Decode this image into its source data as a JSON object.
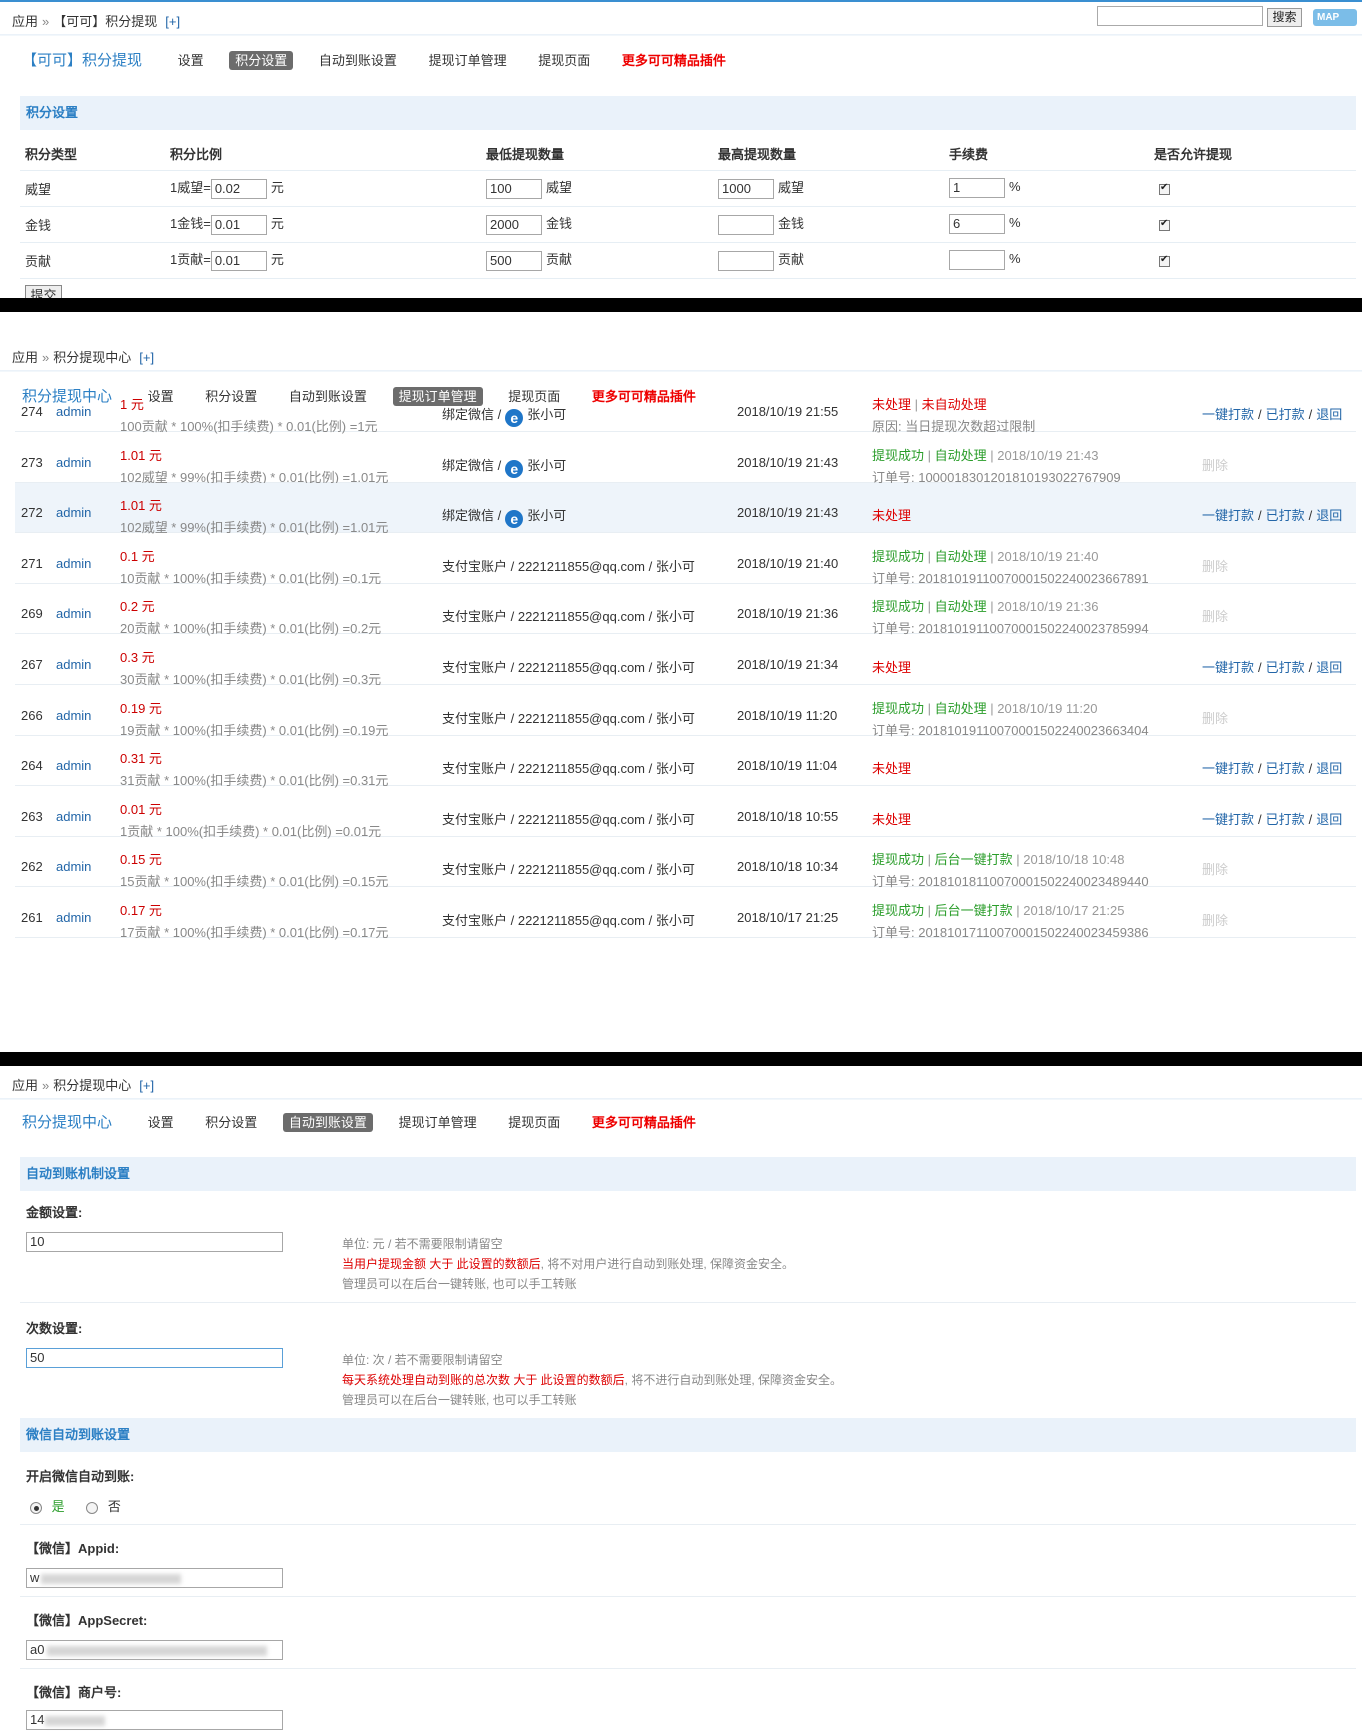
{
  "panel1": {
    "breadcrumb": [
      "应用",
      "【可可】积分提现"
    ],
    "breadcrumb_plus": "[+]",
    "search_button": "搜索",
    "map_button": "MAP",
    "nav": {
      "brand": "【可可】积分提现",
      "items": [
        "设置",
        "积分设置",
        "自动到账设置",
        "提现订单管理",
        "提现页面"
      ],
      "active_index": 1,
      "more": "更多可可精品插件"
    },
    "section_title": "积分设置",
    "table": {
      "headers": [
        "积分类型",
        "积分比例",
        "最低提现数量",
        "最高提现数量",
        "手续费",
        "是否允许提现"
      ],
      "rows": [
        {
          "type": "威望",
          "ratio_prefix": "1威望=",
          "ratio": "0.02",
          "ratio_unit": "元",
          "min": "100",
          "min_unit": "威望",
          "max": "1000",
          "max_unit": "威望",
          "fee": "1",
          "fee_unit": "%",
          "allowed": true
        },
        {
          "type": "金钱",
          "ratio_prefix": "1金钱=",
          "ratio": "0.01",
          "ratio_unit": "元",
          "min": "2000",
          "min_unit": "金钱",
          "max": "",
          "max_unit": "金钱",
          "fee": "6",
          "fee_unit": "%",
          "allowed": true
        },
        {
          "type": "贡献",
          "ratio_prefix": "1贡献=",
          "ratio": "0.01",
          "ratio_unit": "元",
          "min": "500",
          "min_unit": "贡献",
          "max": "",
          "max_unit": "贡献",
          "fee": "",
          "fee_unit": "%",
          "allowed": true
        }
      ]
    },
    "submit": "提交"
  },
  "panel2": {
    "breadcrumb": [
      "应用",
      "积分提现中心"
    ],
    "breadcrumb_plus": "[+]",
    "nav": {
      "brand": "积分提现中心",
      "items": [
        "设置",
        "积分设置",
        "自动到账设置",
        "提现订单管理",
        "提现页面"
      ],
      "active_index": 3,
      "more": "更多可可精品插件"
    },
    "ops": [
      "一键打款",
      "已打款",
      "退回"
    ],
    "delete_label": "删除",
    "orders": [
      {
        "id": "274",
        "user": "admin",
        "amount": "1 元",
        "formula": "100贡献 * 100%(扣手续费) * 0.01(比例) =1元",
        "account": "绑定微信 /",
        "account_name": "张小可",
        "wechat": true,
        "time": "2018/10/19 21:55",
        "status": "未处理",
        "status2": "未自动处理",
        "status_time": "",
        "note": "原因: 当日提现次数超过限制",
        "processed": false
      },
      {
        "id": "273",
        "user": "admin",
        "amount": "1.01 元",
        "formula": "102威望 * 99%(扣手续费) * 0.01(比例) =1.01元",
        "account": "绑定微信 /",
        "account_name": "张小可",
        "wechat": true,
        "time": "2018/10/19 21:43",
        "status": "提现成功",
        "status2": "自动处理",
        "status_time": "2018/10/19 21:43",
        "note": "订单号: 1000018301201810193022767909",
        "processed": true
      },
      {
        "id": "272",
        "user": "admin",
        "amount": "1.01 元",
        "formula": "102威望 * 99%(扣手续费) * 0.01(比例) =1.01元",
        "account": "绑定微信 /",
        "account_name": "张小可",
        "wechat": true,
        "time": "2018/10/19 21:43",
        "status": "未处理",
        "status2": "",
        "status_time": "",
        "note": "",
        "processed": false
      },
      {
        "id": "271",
        "user": "admin",
        "amount": "0.1 元",
        "formula": "10贡献 * 100%(扣手续费) * 0.01(比例) =0.1元",
        "account": "支付宝账户 / 2221211855@qq.com / 张小可",
        "account_name": "",
        "wechat": false,
        "time": "2018/10/19 21:40",
        "status": "提现成功",
        "status2": "自动处理",
        "status_time": "2018/10/19 21:40",
        "note": "订单号: 20181019110070001502240023667891",
        "processed": true
      },
      {
        "id": "269",
        "user": "admin",
        "amount": "0.2 元",
        "formula": "20贡献 * 100%(扣手续费) * 0.01(比例) =0.2元",
        "account": "支付宝账户 / 2221211855@qq.com / 张小可",
        "account_name": "",
        "wechat": false,
        "time": "2018/10/19 21:36",
        "status": "提现成功",
        "status2": "自动处理",
        "status_time": "2018/10/19 21:36",
        "note": "订单号: 20181019110070001502240023785994",
        "processed": true
      },
      {
        "id": "267",
        "user": "admin",
        "amount": "0.3 元",
        "formula": "30贡献 * 100%(扣手续费) * 0.01(比例) =0.3元",
        "account": "支付宝账户 / 2221211855@qq.com / 张小可",
        "account_name": "",
        "wechat": false,
        "time": "2018/10/19 21:34",
        "status": "未处理",
        "status2": "",
        "status_time": "",
        "note": "",
        "processed": false
      },
      {
        "id": "266",
        "user": "admin",
        "amount": "0.19 元",
        "formula": "19贡献 * 100%(扣手续费) * 0.01(比例) =0.19元",
        "account": "支付宝账户 / 2221211855@qq.com / 张小可",
        "account_name": "",
        "wechat": false,
        "time": "2018/10/19 11:20",
        "status": "提现成功",
        "status2": "自动处理",
        "status_time": "2018/10/19 11:20",
        "note": "订单号: 20181019110070001502240023663404",
        "processed": true
      },
      {
        "id": "264",
        "user": "admin",
        "amount": "0.31 元",
        "formula": "31贡献 * 100%(扣手续费) * 0.01(比例) =0.31元",
        "account": "支付宝账户 / 2221211855@qq.com / 张小可",
        "account_name": "",
        "wechat": false,
        "time": "2018/10/19 11:04",
        "status": "未处理",
        "status2": "",
        "status_time": "",
        "note": "",
        "processed": false
      },
      {
        "id": "263",
        "user": "admin",
        "amount": "0.01 元",
        "formula": "1贡献 * 100%(扣手续费) * 0.01(比例) =0.01元",
        "account": "支付宝账户 / 2221211855@qq.com / 张小可",
        "account_name": "",
        "wechat": false,
        "time": "2018/10/18 10:55",
        "status": "未处理",
        "status2": "",
        "status_time": "",
        "note": "",
        "processed": false
      },
      {
        "id": "262",
        "user": "admin",
        "amount": "0.15 元",
        "formula": "15贡献 * 100%(扣手续费) * 0.01(比例) =0.15元",
        "account": "支付宝账户 / 2221211855@qq.com / 张小可",
        "account_name": "",
        "wechat": false,
        "time": "2018/10/18 10:34",
        "status": "提现成功",
        "status2": "后台一键打款",
        "status_time": "2018/10/18 10:48",
        "note": "订单号: 20181018110070001502240023489440",
        "processed": true
      },
      {
        "id": "261",
        "user": "admin",
        "amount": "0.17 元",
        "formula": "17贡献 * 100%(扣手续费) * 0.01(比例) =0.17元",
        "account": "支付宝账户 / 2221211855@qq.com / 张小可",
        "account_name": "",
        "wechat": false,
        "time": "2018/10/17 21:25",
        "status": "提现成功",
        "status2": "后台一键打款",
        "status_time": "2018/10/17 21:25",
        "note": "订单号: 20181017110070001502240023459386",
        "processed": true
      }
    ]
  },
  "panel3": {
    "breadcrumb": [
      "应用",
      "积分提现中心"
    ],
    "breadcrumb_plus": "[+]",
    "nav": {
      "brand": "积分提现中心",
      "items": [
        "设置",
        "积分设置",
        "自动到账设置",
        "提现订单管理",
        "提现页面"
      ],
      "active_index": 2,
      "more": "更多可可精品插件"
    },
    "section1_title": "自动到账机制设置",
    "amount_label": "金额设置:",
    "amount_value": "10",
    "amount_hint1": "单位: 元 / 若不需要限制请留空",
    "amount_hint2_red": "当用户提现金额 大于 此设置的数额后",
    "amount_hint2_rest": ", 将不对用户进行自动到账处理, 保障资金安全。",
    "amount_hint3": "管理员可以在后台一键转账, 也可以手工转账",
    "count_label": "次数设置:",
    "count_value": "50",
    "count_hint1": "单位: 次 / 若不需要限制请留空",
    "count_hint2_red": "每天系统处理自动到账的总次数 大于 此设置的数额后",
    "count_hint2_rest": ", 将不进行自动到账处理, 保障资金安全。",
    "count_hint3": "管理员可以在后台一键转账, 也可以手工转账",
    "section2_title": "微信自动到账设置",
    "wechat_enable_label": "开启微信自动到账:",
    "radio_yes": "是",
    "radio_no": "否",
    "appid_label": "【微信】Appid:",
    "appid_value": "w",
    "appsecret_label": "【微信】AppSecret:",
    "appsecret_value": "a0",
    "mchid_label": "【微信】商户号:",
    "mchid_value": "14"
  }
}
